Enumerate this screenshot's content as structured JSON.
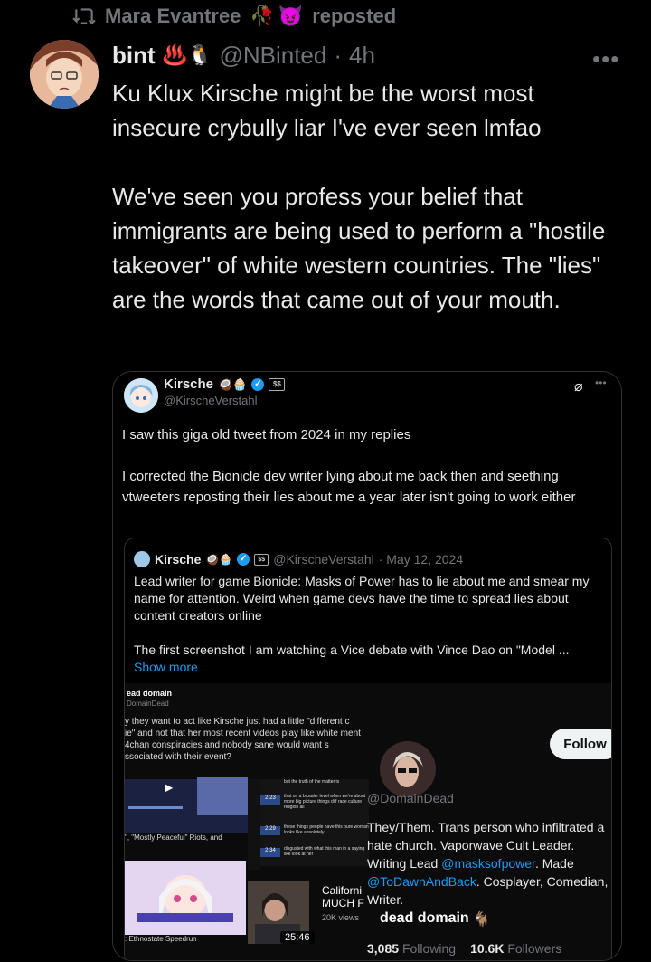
{
  "repost": {
    "icon": "repost-icon",
    "user": "Mara Evantree",
    "emoji1": "🥀",
    "emoji2": "😈",
    "label": "reposted"
  },
  "tweet": {
    "name": "bint",
    "emoji": "♨️🐧",
    "handle": "@NBinted",
    "sep": "·",
    "time": "4h",
    "more": "•••",
    "text": "Ku Klux Kirsche might be the worst most insecure crybully liar I've ever seen lmfao\n\nWe've seen you profess your belief that immigrants are  being used to perform a \"hostile takeover\" of white western countries. The \"lies\" are the words that came out of your mouth."
  },
  "quote": {
    "name": "Kirsche",
    "emoji": "🥥🧁",
    "handle": "@KirscheVerstahl",
    "text": "I saw this giga old tweet from 2024 in my replies\n\nI corrected the Bionicle dev writer lying about me back then and seething vtweeters reposting their lies about me a year later isn't going to work either",
    "inner": {
      "name": "Kirsche",
      "emoji": "🥥🧁",
      "handle": "@KirscheVerstahl",
      "date": "· May 12, 2024",
      "text": "Lead writer for game Bionicle: Masks of Power has to lie about me and smear my name for attention. Weird when game devs have the time to spread lies about content creators online\n\nThe first screenshot I am watching a Vice debate with Vince Dao on \"Model ...",
      "show_more": "Show more",
      "media": {
        "left_name": "ead domain",
        "left_handle": "DomainDead",
        "left_text": "y they want to act like Kirsche just had a little \"different c ie\" and not that her most recent videos play like white ment 4chan conspiracies and nobody sane would want s ssociated with their event?",
        "clip1": "but the truth of the matter is",
        "clip2": "that on a broader level when we're about more big picture things diff race culture religion all",
        "clip3": "these things people have this pure woman looks like absolutely",
        "clip4": "disgusted with what this man in a saying like look at her",
        "ts1": "2:23",
        "ts2": "2:29",
        "ts3": "2:34",
        "mp": "\", \"Mostly Peaceful\" Riots, and",
        "ethno": ": Ethnostate Speedrun",
        "cal_title": "Californi MUCH F",
        "cal_views": "20K views",
        "duration": "25:46",
        "follow": "Follow",
        "profile_name": "dead domain",
        "profile_emoji": "🐐",
        "profile_handle": "@DomainDead",
        "bio1": "They/Them. Trans person who infiltrated a hate church. Vaporwave Cult Leader. Writing Lead ",
        "bio_link1": "@masksofpower",
        "bio2": ". Made ",
        "bio_link2": "@ToDawnAndBack",
        "bio3": ". Cosplayer, Comedian, Writer.",
        "following_count": "3,085",
        "following_label": "Following",
        "followers_count": "10.6K",
        "followers_label": "Followers"
      }
    }
  }
}
